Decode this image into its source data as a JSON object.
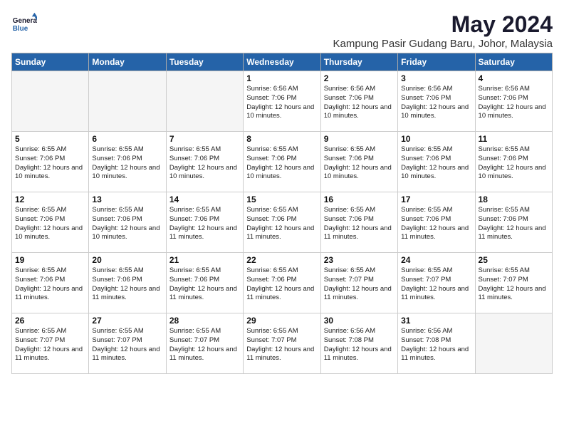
{
  "header": {
    "logo_line1": "General",
    "logo_line2": "Blue",
    "month": "May 2024",
    "location": "Kampung Pasir Gudang Baru, Johor, Malaysia"
  },
  "days_of_week": [
    "Sunday",
    "Monday",
    "Tuesday",
    "Wednesday",
    "Thursday",
    "Friday",
    "Saturday"
  ],
  "weeks": [
    [
      {
        "day": "",
        "empty": true
      },
      {
        "day": "",
        "empty": true
      },
      {
        "day": "",
        "empty": true
      },
      {
        "day": "1",
        "sunrise": "6:56 AM",
        "sunset": "7:06 PM",
        "daylight": "12 hours and 10 minutes."
      },
      {
        "day": "2",
        "sunrise": "6:56 AM",
        "sunset": "7:06 PM",
        "daylight": "12 hours and 10 minutes."
      },
      {
        "day": "3",
        "sunrise": "6:56 AM",
        "sunset": "7:06 PM",
        "daylight": "12 hours and 10 minutes."
      },
      {
        "day": "4",
        "sunrise": "6:56 AM",
        "sunset": "7:06 PM",
        "daylight": "12 hours and 10 minutes."
      }
    ],
    [
      {
        "day": "5",
        "sunrise": "6:55 AM",
        "sunset": "7:06 PM",
        "daylight": "12 hours and 10 minutes."
      },
      {
        "day": "6",
        "sunrise": "6:55 AM",
        "sunset": "7:06 PM",
        "daylight": "12 hours and 10 minutes."
      },
      {
        "day": "7",
        "sunrise": "6:55 AM",
        "sunset": "7:06 PM",
        "daylight": "12 hours and 10 minutes."
      },
      {
        "day": "8",
        "sunrise": "6:55 AM",
        "sunset": "7:06 PM",
        "daylight": "12 hours and 10 minutes."
      },
      {
        "day": "9",
        "sunrise": "6:55 AM",
        "sunset": "7:06 PM",
        "daylight": "12 hours and 10 minutes."
      },
      {
        "day": "10",
        "sunrise": "6:55 AM",
        "sunset": "7:06 PM",
        "daylight": "12 hours and 10 minutes."
      },
      {
        "day": "11",
        "sunrise": "6:55 AM",
        "sunset": "7:06 PM",
        "daylight": "12 hours and 10 minutes."
      }
    ],
    [
      {
        "day": "12",
        "sunrise": "6:55 AM",
        "sunset": "7:06 PM",
        "daylight": "12 hours and 10 minutes."
      },
      {
        "day": "13",
        "sunrise": "6:55 AM",
        "sunset": "7:06 PM",
        "daylight": "12 hours and 10 minutes."
      },
      {
        "day": "14",
        "sunrise": "6:55 AM",
        "sunset": "7:06 PM",
        "daylight": "12 hours and 11 minutes."
      },
      {
        "day": "15",
        "sunrise": "6:55 AM",
        "sunset": "7:06 PM",
        "daylight": "12 hours and 11 minutes."
      },
      {
        "day": "16",
        "sunrise": "6:55 AM",
        "sunset": "7:06 PM",
        "daylight": "12 hours and 11 minutes."
      },
      {
        "day": "17",
        "sunrise": "6:55 AM",
        "sunset": "7:06 PM",
        "daylight": "12 hours and 11 minutes."
      },
      {
        "day": "18",
        "sunrise": "6:55 AM",
        "sunset": "7:06 PM",
        "daylight": "12 hours and 11 minutes."
      }
    ],
    [
      {
        "day": "19",
        "sunrise": "6:55 AM",
        "sunset": "7:06 PM",
        "daylight": "12 hours and 11 minutes."
      },
      {
        "day": "20",
        "sunrise": "6:55 AM",
        "sunset": "7:06 PM",
        "daylight": "12 hours and 11 minutes."
      },
      {
        "day": "21",
        "sunrise": "6:55 AM",
        "sunset": "7:06 PM",
        "daylight": "12 hours and 11 minutes."
      },
      {
        "day": "22",
        "sunrise": "6:55 AM",
        "sunset": "7:06 PM",
        "daylight": "12 hours and 11 minutes."
      },
      {
        "day": "23",
        "sunrise": "6:55 AM",
        "sunset": "7:07 PM",
        "daylight": "12 hours and 11 minutes."
      },
      {
        "day": "24",
        "sunrise": "6:55 AM",
        "sunset": "7:07 PM",
        "daylight": "12 hours and 11 minutes."
      },
      {
        "day": "25",
        "sunrise": "6:55 AM",
        "sunset": "7:07 PM",
        "daylight": "12 hours and 11 minutes."
      }
    ],
    [
      {
        "day": "26",
        "sunrise": "6:55 AM",
        "sunset": "7:07 PM",
        "daylight": "12 hours and 11 minutes."
      },
      {
        "day": "27",
        "sunrise": "6:55 AM",
        "sunset": "7:07 PM",
        "daylight": "12 hours and 11 minutes."
      },
      {
        "day": "28",
        "sunrise": "6:55 AM",
        "sunset": "7:07 PM",
        "daylight": "12 hours and 11 minutes."
      },
      {
        "day": "29",
        "sunrise": "6:55 AM",
        "sunset": "7:07 PM",
        "daylight": "12 hours and 11 minutes."
      },
      {
        "day": "30",
        "sunrise": "6:56 AM",
        "sunset": "7:08 PM",
        "daylight": "12 hours and 11 minutes."
      },
      {
        "day": "31",
        "sunrise": "6:56 AM",
        "sunset": "7:08 PM",
        "daylight": "12 hours and 11 minutes."
      },
      {
        "day": "",
        "empty": true
      }
    ]
  ],
  "labels": {
    "sunrise": "Sunrise:",
    "sunset": "Sunset:",
    "daylight": "Daylight:"
  }
}
